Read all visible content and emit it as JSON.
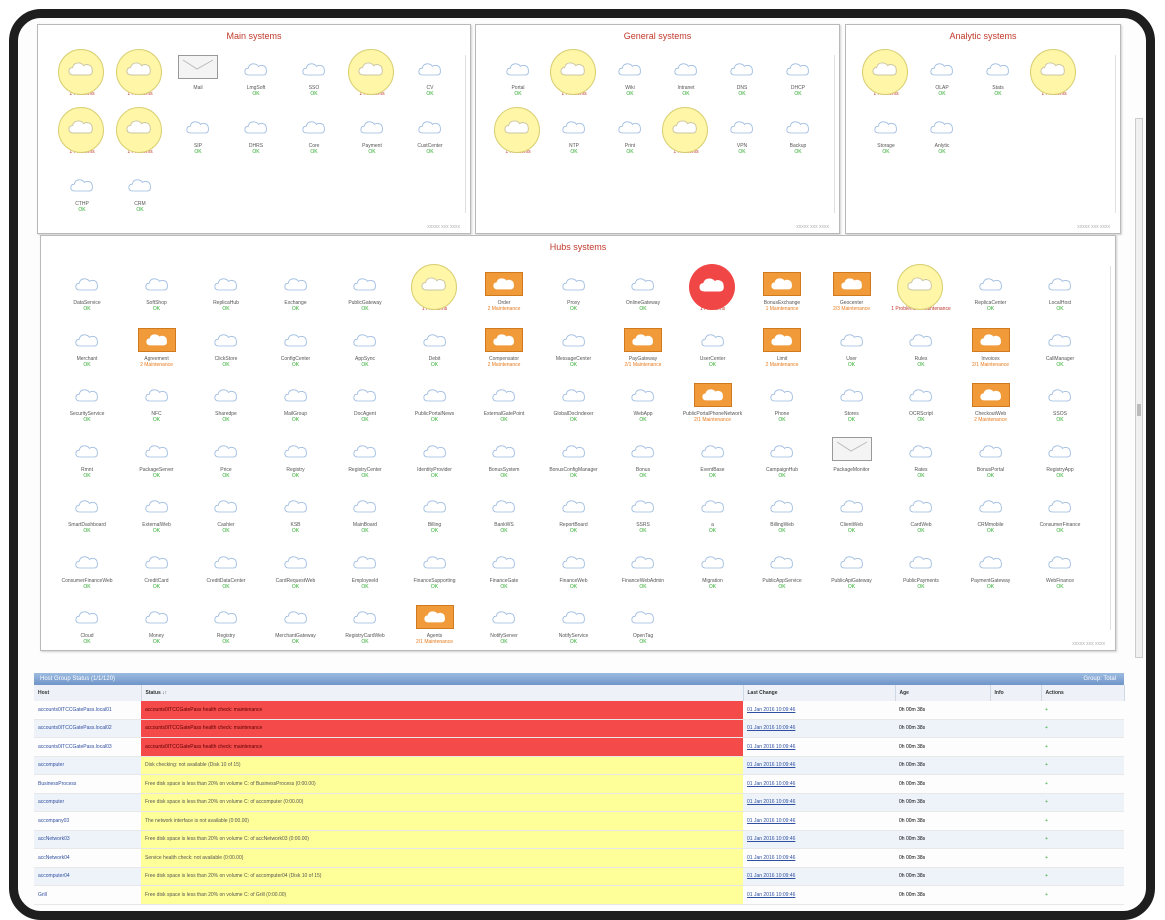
{
  "panels": {
    "main": {
      "title": "Main systems",
      "footer": "xxxxx xxx xxxx",
      "tiles": [
        {
          "name": "IPSHR",
          "status": "1 Problems",
          "state": "problem"
        },
        {
          "name": "Sftp",
          "status": "1 Problems",
          "state": "problem"
        },
        {
          "name": "Mail",
          "status": "",
          "state": "na"
        },
        {
          "name": "LmgSoft",
          "status": "OK",
          "state": "ok"
        },
        {
          "name": "SSO",
          "status": "OK",
          "state": "ok"
        },
        {
          "name": "Softgap",
          "status": "1 Problems",
          "state": "problem"
        },
        {
          "name": "CV",
          "status": "OK",
          "state": "ok"
        },
        {
          "name": "Image",
          "status": "1 Problems",
          "state": "problem"
        },
        {
          "name": "OCMS",
          "status": "1 Problems",
          "state": "problem"
        },
        {
          "name": "SIP",
          "status": "OK",
          "state": "ok"
        },
        {
          "name": "DHRS",
          "status": "OK",
          "state": "ok"
        },
        {
          "name": "Core",
          "status": "OK",
          "state": "ok"
        },
        {
          "name": "Payment",
          "status": "OK",
          "state": "ok"
        },
        {
          "name": "CustCenter",
          "status": "OK",
          "state": "ok"
        },
        {
          "name": "CTHP",
          "status": "OK",
          "state": "ok"
        },
        {
          "name": "CRM",
          "status": "OK",
          "state": "ok"
        }
      ]
    },
    "general": {
      "title": "General systems",
      "footer": "xxxxx xxx xxxx",
      "tiles": [
        {
          "name": "Portal",
          "status": "OK",
          "state": "ok"
        },
        {
          "name": "Exchange",
          "status": "1 Problems",
          "state": "problem"
        },
        {
          "name": "Wiki",
          "status": "OK",
          "state": "ok"
        },
        {
          "name": "Intranet",
          "status": "OK",
          "state": "ok"
        },
        {
          "name": "DNS",
          "status": "OK",
          "state": "ok"
        },
        {
          "name": "DHCP",
          "status": "OK",
          "state": "ok"
        },
        {
          "name": "FileCenter",
          "status": "1 Problems",
          "state": "problem"
        },
        {
          "name": "NTP",
          "status": "OK",
          "state": "ok"
        },
        {
          "name": "Print",
          "status": "OK",
          "state": "ok"
        },
        {
          "name": "AD",
          "status": "1 Problems",
          "state": "problem"
        },
        {
          "name": "VPN",
          "status": "OK",
          "state": "ok"
        },
        {
          "name": "Backup",
          "status": "OK",
          "state": "ok"
        }
      ]
    },
    "analytic": {
      "title": "Analytic systems",
      "footer": "xxxxx xxx xxxx",
      "tiles": [
        {
          "name": "Hits",
          "status": "1 Problems",
          "state": "problem"
        },
        {
          "name": "OLAP",
          "status": "OK",
          "state": "ok"
        },
        {
          "name": "Stats",
          "status": "OK",
          "state": "ok"
        },
        {
          "name": "Reports",
          "status": "1 Problems",
          "state": "problem"
        },
        {
          "name": "Storage",
          "status": "OK",
          "state": "ok"
        },
        {
          "name": "Anlytic",
          "status": "OK",
          "state": "ok"
        }
      ]
    },
    "hubs": {
      "title": "Hubs systems",
      "footer": "xxxxx xxx xxxx",
      "tiles": [
        {
          "name": "DataService",
          "status": "OK",
          "state": "ok"
        },
        {
          "name": "SoftShop",
          "status": "OK",
          "state": "ok"
        },
        {
          "name": "ReplicaHub",
          "status": "OK",
          "state": "ok"
        },
        {
          "name": "Exchange",
          "status": "OK",
          "state": "ok"
        },
        {
          "name": "PublicGateway",
          "status": "OK",
          "state": "ok"
        },
        {
          "name": "GR",
          "status": "1 Problems",
          "state": "problem"
        },
        {
          "name": "Order",
          "status": "2 Maintenance",
          "state": "warn"
        },
        {
          "name": "Proxy",
          "status": "OK",
          "state": "ok"
        },
        {
          "name": "OnlineGateway",
          "status": "OK",
          "state": "ok"
        },
        {
          "name": "StoreHub",
          "status": "1 Problems",
          "state": "critical"
        },
        {
          "name": "BonusExchange",
          "status": "1 Maintenance",
          "state": "warn"
        },
        {
          "name": "Geocenter",
          "status": "2/3 Maintenance",
          "state": "warn"
        },
        {
          "name": "Stage",
          "status": "1 Problems 2 Maintenance",
          "state": "problem"
        },
        {
          "name": "ReplicaCenter",
          "status": "OK",
          "state": "ok"
        },
        {
          "name": "LocalHost",
          "status": "OK",
          "state": "ok"
        },
        {
          "name": "Merchant",
          "status": "OK",
          "state": "ok"
        },
        {
          "name": "Agreement",
          "status": "2 Maintenance",
          "state": "warn"
        },
        {
          "name": "ClickStore",
          "status": "OK",
          "state": "ok"
        },
        {
          "name": "ConfigCenter",
          "status": "OK",
          "state": "ok"
        },
        {
          "name": "AppSync",
          "status": "OK",
          "state": "ok"
        },
        {
          "name": "Debit",
          "status": "OK",
          "state": "ok"
        },
        {
          "name": "Compensator",
          "status": "2 Maintenance",
          "state": "warn"
        },
        {
          "name": "MessageCenter",
          "status": "OK",
          "state": "ok"
        },
        {
          "name": "PayGateway",
          "status": "2/1 Maintenance",
          "state": "warn"
        },
        {
          "name": "UserCenter",
          "status": "OK",
          "state": "ok"
        },
        {
          "name": "Limit",
          "status": "2 Maintenance",
          "state": "warn"
        },
        {
          "name": "User",
          "status": "OK",
          "state": "ok"
        },
        {
          "name": "Rules",
          "status": "OK",
          "state": "ok"
        },
        {
          "name": "Invoices",
          "status": "2/1 Maintenance",
          "state": "warn"
        },
        {
          "name": "CallManager",
          "status": "OK",
          "state": "ok"
        },
        {
          "name": "SecurityService",
          "status": "OK",
          "state": "ok"
        },
        {
          "name": "NFC",
          "status": "OK",
          "state": "ok"
        },
        {
          "name": "Sharedpe",
          "status": "OK",
          "state": "ok"
        },
        {
          "name": "MailGroup",
          "status": "OK",
          "state": "ok"
        },
        {
          "name": "DocAgent",
          "status": "OK",
          "state": "ok"
        },
        {
          "name": "PublicPortalNews",
          "status": "OK",
          "state": "ok"
        },
        {
          "name": "ExternalGatePoint",
          "status": "OK",
          "state": "ok"
        },
        {
          "name": "GlobalDocIndexer",
          "status": "OK",
          "state": "ok"
        },
        {
          "name": "WebApp",
          "status": "OK",
          "state": "ok"
        },
        {
          "name": "PublicPortalPhoneNetwork",
          "status": "2/1 Maintenance",
          "state": "warn"
        },
        {
          "name": "Phone",
          "status": "OK",
          "state": "ok"
        },
        {
          "name": "Stores",
          "status": "OK",
          "state": "ok"
        },
        {
          "name": "OCRScript",
          "status": "OK",
          "state": "ok"
        },
        {
          "name": "CheckoutWeb",
          "status": "2 Maintenance",
          "state": "warn"
        },
        {
          "name": "SSOS",
          "status": "OK",
          "state": "ok"
        },
        {
          "name": "Rmnt",
          "status": "OK",
          "state": "ok"
        },
        {
          "name": "PackageServer",
          "status": "OK",
          "state": "ok"
        },
        {
          "name": "Price",
          "status": "OK",
          "state": "ok"
        },
        {
          "name": "Registry",
          "status": "OK",
          "state": "ok"
        },
        {
          "name": "RegistryCenter",
          "status": "OK",
          "state": "ok"
        },
        {
          "name": "IdentityProvider",
          "status": "OK",
          "state": "ok"
        },
        {
          "name": "BonusSystem",
          "status": "OK",
          "state": "ok"
        },
        {
          "name": "BonusConfigManager",
          "status": "OK",
          "state": "ok"
        },
        {
          "name": "Bonus",
          "status": "OK",
          "state": "ok"
        },
        {
          "name": "EventBase",
          "status": "OK",
          "state": "ok"
        },
        {
          "name": "CampaignHub",
          "status": "OK",
          "state": "ok"
        },
        {
          "name": "PackageMonitor",
          "status": "",
          "state": "na"
        },
        {
          "name": "Rates",
          "status": "OK",
          "state": "ok"
        },
        {
          "name": "BonusPortal",
          "status": "OK",
          "state": "ok"
        },
        {
          "name": "RegistryApp",
          "status": "OK",
          "state": "ok"
        },
        {
          "name": "SmartDashboard",
          "status": "OK",
          "state": "ok"
        },
        {
          "name": "ExternalWeb",
          "status": "OK",
          "state": "ok"
        },
        {
          "name": "Cashier",
          "status": "OK",
          "state": "ok"
        },
        {
          "name": "KSB",
          "status": "OK",
          "state": "ok"
        },
        {
          "name": "MainBoard",
          "status": "OK",
          "state": "ok"
        },
        {
          "name": "Billing",
          "status": "OK",
          "state": "ok"
        },
        {
          "name": "BankWS",
          "status": "OK",
          "state": "ok"
        },
        {
          "name": "ReportBoard",
          "status": "OK",
          "state": "ok"
        },
        {
          "name": "SSRS",
          "status": "OK",
          "state": "ok"
        },
        {
          "name": "a",
          "status": "OK",
          "state": "ok"
        },
        {
          "name": "BillingWeb",
          "status": "OK",
          "state": "ok"
        },
        {
          "name": "ClientWeb",
          "status": "OK",
          "state": "ok"
        },
        {
          "name": "CardWeb",
          "status": "OK",
          "state": "ok"
        },
        {
          "name": "CRMmobile",
          "status": "OK",
          "state": "ok"
        },
        {
          "name": "ConsumerFinance",
          "status": "OK",
          "state": "ok"
        },
        {
          "name": "ConsumerFinanceWeb",
          "status": "OK",
          "state": "ok"
        },
        {
          "name": "CreditCard",
          "status": "OK",
          "state": "ok"
        },
        {
          "name": "CreditDataCenter",
          "status": "OK",
          "state": "ok"
        },
        {
          "name": "CardRequestWeb",
          "status": "OK",
          "state": "ok"
        },
        {
          "name": "EmployeeId",
          "status": "OK",
          "state": "ok"
        },
        {
          "name": "FinanceSupporting",
          "status": "OK",
          "state": "ok"
        },
        {
          "name": "FinanceGate",
          "status": "OK",
          "state": "ok"
        },
        {
          "name": "FinanceWeb",
          "status": "OK",
          "state": "ok"
        },
        {
          "name": "FinanceWebAdmin",
          "status": "OK",
          "state": "ok"
        },
        {
          "name": "Migration",
          "status": "OK",
          "state": "ok"
        },
        {
          "name": "PublicAppService",
          "status": "OK",
          "state": "ok"
        },
        {
          "name": "PublicApiGateway",
          "status": "OK",
          "state": "ok"
        },
        {
          "name": "PublicPayments",
          "status": "OK",
          "state": "ok"
        },
        {
          "name": "PaymentGateway",
          "status": "OK",
          "state": "ok"
        },
        {
          "name": "WebFinance",
          "status": "OK",
          "state": "ok"
        },
        {
          "name": "Cloud",
          "status": "OK",
          "state": "ok"
        },
        {
          "name": "Money",
          "status": "OK",
          "state": "ok"
        },
        {
          "name": "Registry",
          "status": "OK",
          "state": "ok"
        },
        {
          "name": "MerchantGateway",
          "status": "OK",
          "state": "ok"
        },
        {
          "name": "RegistryCardWeb",
          "status": "OK",
          "state": "ok"
        },
        {
          "name": "Agents",
          "status": "2/1 Maintenance",
          "state": "warn"
        },
        {
          "name": "NotifyServer",
          "status": "OK",
          "state": "ok"
        },
        {
          "name": "NotifyService",
          "status": "OK",
          "state": "ok"
        },
        {
          "name": "OpenTag",
          "status": "OK",
          "state": "ok"
        }
      ]
    }
  },
  "grid": {
    "title": "Host Group Status (1/1/120)",
    "right_label": "Group: Total",
    "columns": [
      "Host",
      "Status ↓↑",
      "Last Change",
      "Age",
      "Info",
      "Actions"
    ],
    "rows": [
      {
        "host": "accounts0ITCCGatePass.local01",
        "status": "accounts0ITCCGatePass health check: maintenance",
        "state": "crit",
        "last": "01 Jan 2016 10:09:46",
        "age": "0h 00m 38s",
        "info": "",
        "act": "+"
      },
      {
        "host": "accounts0ITCCGatePass.local02",
        "status": "accounts0ITCCGatePass health check: maintenance",
        "state": "crit",
        "last": "01 Jan 2016 10:09:46",
        "age": "0h 00m 38s",
        "info": "",
        "act": "+"
      },
      {
        "host": "accounts0ITCCGatePass.local03",
        "status": "accounts0ITCCGatePass health check: maintenance",
        "state": "crit",
        "last": "01 Jan 2016 10:09:46",
        "age": "0h 00m 38s",
        "info": "",
        "act": "+"
      },
      {
        "host": "accomputer",
        "status": "Disk checking: not available (Disk 10 of 15)",
        "state": "warn",
        "last": "01 Jan 2016 10:09:46",
        "age": "0h 00m 38s",
        "info": "",
        "act": "+"
      },
      {
        "host": "BusinessProcess",
        "status": "Free disk space is less than 20% on volume C: of BusinessProcess (0:00.00)",
        "state": "warn",
        "last": "01 Jan 2016 10:09:46",
        "age": "0h 00m 38s",
        "info": "",
        "act": "+"
      },
      {
        "host": "accomputer",
        "status": "Free disk space is less than 20% on volume C: of accomputer (0:00.00)",
        "state": "warn",
        "last": "01 Jan 2016 10:09:46",
        "age": "0h 00m 38s",
        "info": "",
        "act": "+"
      },
      {
        "host": "accompany03",
        "status": "The network interface is not available (0:00.00)",
        "state": "warn",
        "last": "01 Jan 2016 10:09:46",
        "age": "0h 00m 38s",
        "info": "",
        "act": "+"
      },
      {
        "host": "accNetwork03",
        "status": "Free disk space is less than 20% on volume C: of accNetwork03 (0:00.00)",
        "state": "warn",
        "last": "01 Jan 2016 10:09:46",
        "age": "0h 00m 38s",
        "info": "",
        "act": "+"
      },
      {
        "host": "accNetwork04",
        "status": "Service health check: not available (0:00.00)",
        "state": "warn",
        "last": "01 Jan 2016 10:09:46",
        "age": "0h 00m 38s",
        "info": "",
        "act": "+"
      },
      {
        "host": "accomputer04",
        "status": "Free disk space is less than 20% on volume C: of accomputer04 (Disk 10 of 15)",
        "state": "warn",
        "last": "01 Jan 2016 10:09:46",
        "age": "0h 00m 38s",
        "info": "",
        "act": "+"
      },
      {
        "host": "Grill",
        "status": "Free disk space is less than 20% on volume C: of Grill (0:00.00)",
        "state": "warn",
        "last": "01 Jan 2016 10:09:46",
        "age": "0h 00m 38s",
        "info": "",
        "act": "+"
      }
    ]
  },
  "colors": {
    "ok": "#2eaa2e",
    "problem": "#c0392b",
    "warn": "#e87a1c",
    "critical": "#f04646"
  }
}
